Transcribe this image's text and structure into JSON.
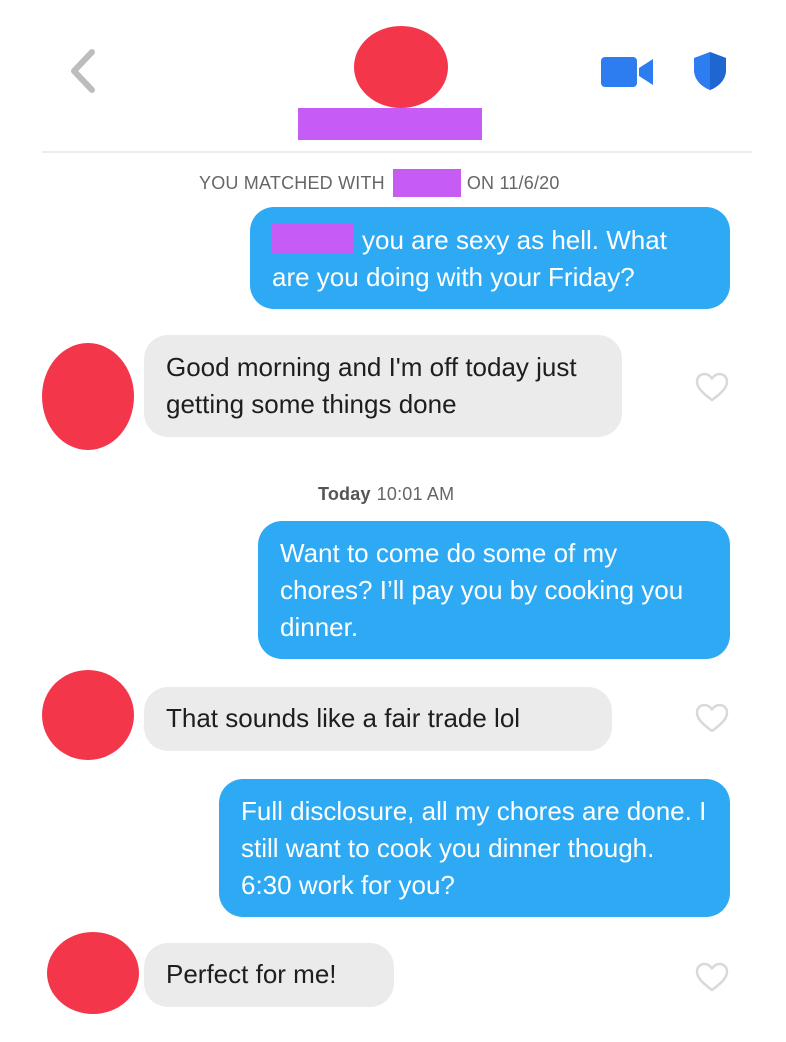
{
  "header": {
    "back_icon": "chevron-left-icon",
    "video_icon": "video-camera-icon",
    "safety_icon": "shield-icon",
    "accent_color": "#2e7df0"
  },
  "match_banner": {
    "prefix": "YOU MATCHED WITH",
    "suffix": "ON 11/6/20"
  },
  "timestamp": {
    "day": "Today",
    "time": "10:01 AM"
  },
  "messages": [
    {
      "sender": "me",
      "text": "you are sexy as hell. What are you doing with your Friday?"
    },
    {
      "sender": "match",
      "text": "Good morning and I'm off today just getting some things done"
    },
    {
      "sender": "me",
      "text": "Want to come do some of my chores?  I’ll pay you by cooking you dinner."
    },
    {
      "sender": "match",
      "text": "That sounds like a fair trade lol"
    },
    {
      "sender": "me",
      "text": "Full disclosure, all my chores are done. I still want to cook you dinner though. 6:30 work for you?"
    },
    {
      "sender": "match",
      "text": "Perfect for me!"
    }
  ],
  "colors": {
    "outgoing_bubble": "#2eaaf5",
    "incoming_bubble": "#ebebeb",
    "avatar_redaction": "#f4364a",
    "name_redaction": "#c75cf5"
  }
}
